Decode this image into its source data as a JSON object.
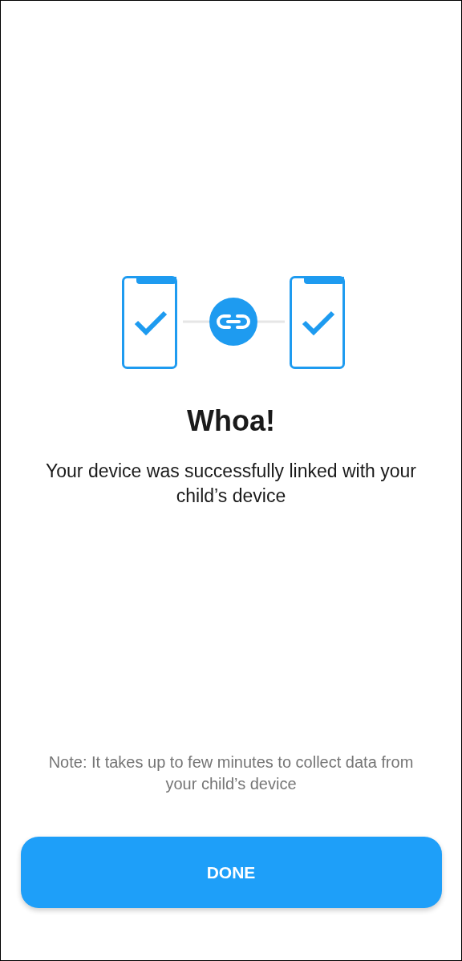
{
  "title": "Whoa!",
  "message": "Your device was successfully linked with your child’s device",
  "note": "Note: It takes up to few minutes to collect data from your child’s device",
  "buttons": [
    "DONE"
  ]
}
